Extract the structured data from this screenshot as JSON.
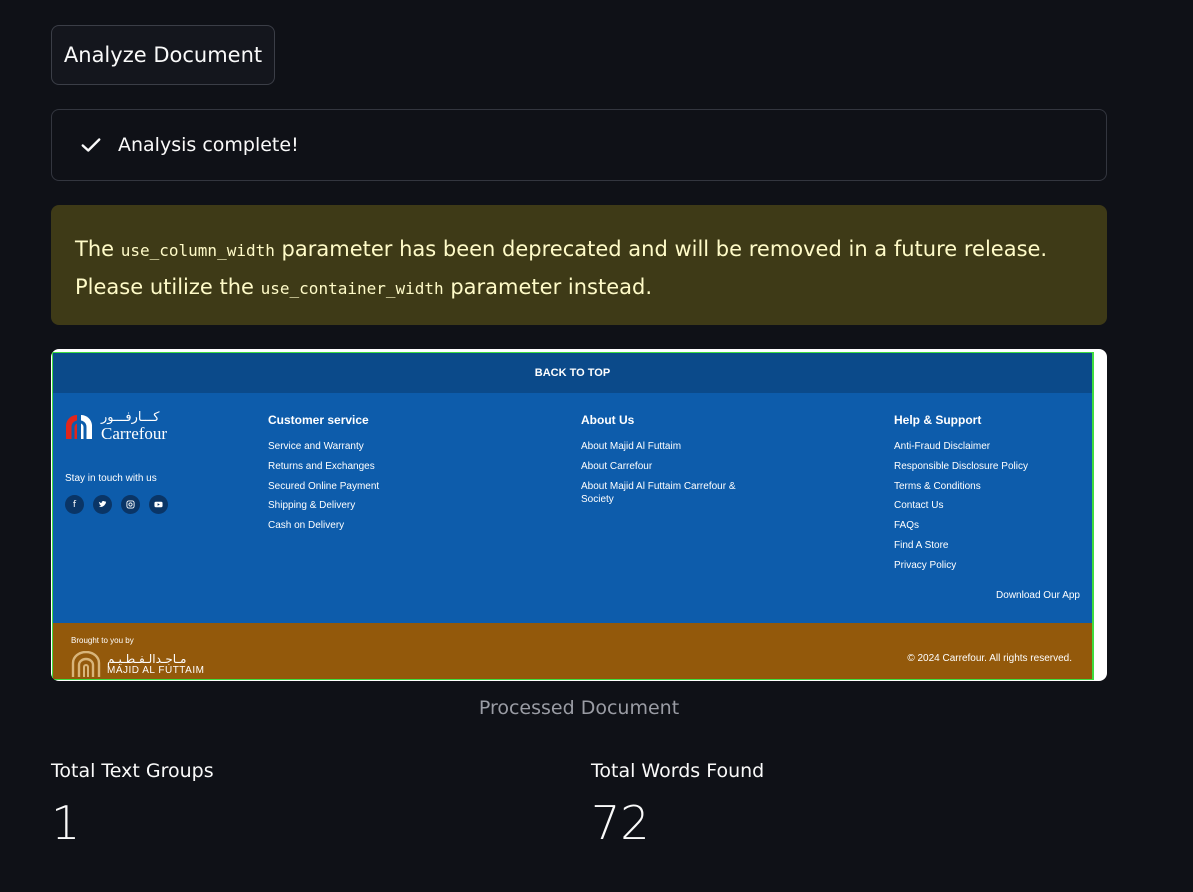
{
  "analyze_button": {
    "label": "Analyze Document"
  },
  "status": {
    "message": "Analysis complete!"
  },
  "warning": {
    "part1": "The ",
    "code1": "use_column_width",
    "part2": " parameter has been deprecated and will be removed in a future release. Please utilize the ",
    "code2": "use_container_width",
    "part3": " parameter instead."
  },
  "document": {
    "back_to_top": "BACK TO TOP",
    "brand_arabic": "كـــارفـــور",
    "brand_name": "Carrefour",
    "stay_in_touch": "Stay in touch with us",
    "socials": [
      "facebook-icon",
      "twitter-icon",
      "instagram-icon",
      "youtube-icon"
    ],
    "columns": [
      {
        "title": "Customer service",
        "links": [
          "Service and Warranty",
          "Returns and Exchanges",
          "Secured Online Payment",
          "Shipping & Delivery",
          "Cash on Delivery"
        ]
      },
      {
        "title": "About Us",
        "links": [
          "About Majid Al Futtaim",
          "About Carrefour",
          "About Majid Al Futtaim Carrefour & Society"
        ]
      },
      {
        "title": "Help & Support",
        "links": [
          "Anti-Fraud Disclaimer",
          "Responsible Disclosure Policy",
          "Terms & Conditions",
          "Contact Us",
          "FAQs",
          "Find A Store",
          "Privacy Policy"
        ]
      }
    ],
    "download_app": "Download Our App",
    "brought_by": "Brought to you by",
    "maf_arabic": "مـاجـدالـفـطـيـم",
    "maf_name": "MAJID AL FUTTAIM",
    "copyright": "© 2024 Carrefour. All rights reserved.",
    "colors": {
      "top_bar": "#0b4a8a",
      "main": "#0d5cab",
      "bottom": "#93590b",
      "border": "#3fdc3f"
    }
  },
  "caption": "Processed Document",
  "metrics": [
    {
      "label": "Total Text Groups",
      "value": "1"
    },
    {
      "label": "Total Words Found",
      "value": "72"
    }
  ]
}
